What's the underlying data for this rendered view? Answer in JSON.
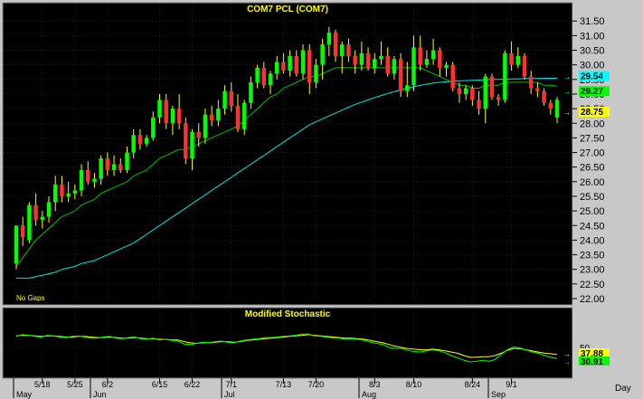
{
  "chart_data": [
    {
      "type": "candlestick",
      "title": "COM7  PCL  (COM7)",
      "note": "No Gaps",
      "ylim": [
        22.0,
        31.6
      ],
      "y_ticks": [
        "31.50",
        "31.00",
        "30.50",
        "30.00",
        "29.50",
        "29.00",
        "28.50",
        "28.00",
        "27.50",
        "27.00",
        "26.50",
        "26.00",
        "25.50",
        "25.00",
        "24.50",
        "24.00",
        "23.50",
        "23.00",
        "22.50",
        "22.00"
      ],
      "ma_labels": [
        "29.54",
        "29.27",
        "28.75"
      ],
      "ma_label_colors": [
        "#00ffff",
        "#00ff00",
        "#ffff00"
      ],
      "candle_colors": {
        "up": "#00ff00",
        "down": "#ff3030",
        "wick": "#ffff00"
      },
      "series_colors": {
        "ma_long": "#00e5e5",
        "ma_short": "#00c000"
      },
      "candles": [
        {
          "o": 23.2,
          "h": 24.5,
          "l": 23.0,
          "c": 24.5
        },
        {
          "o": 24.5,
          "h": 24.8,
          "l": 23.8,
          "c": 24.1
        },
        {
          "o": 24.0,
          "h": 25.3,
          "l": 23.9,
          "c": 25.2
        },
        {
          "o": 25.2,
          "h": 25.6,
          "l": 24.5,
          "c": 24.7
        },
        {
          "o": 24.7,
          "h": 25.0,
          "l": 24.4,
          "c": 24.8
        },
        {
          "o": 24.8,
          "h": 25.5,
          "l": 24.6,
          "c": 25.3
        },
        {
          "o": 25.3,
          "h": 26.2,
          "l": 25.0,
          "c": 25.9
        },
        {
          "o": 25.9,
          "h": 26.2,
          "l": 25.3,
          "c": 25.5
        },
        {
          "o": 25.5,
          "h": 26.0,
          "l": 25.3,
          "c": 25.6
        },
        {
          "o": 25.6,
          "h": 25.9,
          "l": 25.4,
          "c": 25.7
        },
        {
          "o": 25.7,
          "h": 26.6,
          "l": 25.5,
          "c": 26.4
        },
        {
          "o": 26.4,
          "h": 26.7,
          "l": 25.9,
          "c": 26.0
        },
        {
          "o": 26.0,
          "h": 26.3,
          "l": 25.8,
          "c": 26.1
        },
        {
          "o": 26.1,
          "h": 26.9,
          "l": 25.9,
          "c": 26.8
        },
        {
          "o": 26.8,
          "h": 27.0,
          "l": 26.2,
          "c": 26.4
        },
        {
          "o": 26.4,
          "h": 26.9,
          "l": 26.2,
          "c": 26.6
        },
        {
          "o": 26.6,
          "h": 26.8,
          "l": 26.3,
          "c": 26.4
        },
        {
          "o": 26.4,
          "h": 27.2,
          "l": 26.3,
          "c": 27.0
        },
        {
          "o": 27.0,
          "h": 27.8,
          "l": 26.8,
          "c": 27.6
        },
        {
          "o": 27.6,
          "h": 27.8,
          "l": 27.1,
          "c": 27.3
        },
        {
          "o": 27.3,
          "h": 27.6,
          "l": 27.2,
          "c": 27.5
        },
        {
          "o": 27.5,
          "h": 28.4,
          "l": 27.4,
          "c": 28.2
        },
        {
          "o": 28.2,
          "h": 29.0,
          "l": 28.0,
          "c": 28.8
        },
        {
          "o": 28.8,
          "h": 29.0,
          "l": 27.8,
          "c": 28.0
        },
        {
          "o": 28.0,
          "h": 28.6,
          "l": 27.6,
          "c": 28.5
        },
        {
          "o": 28.5,
          "h": 29.0,
          "l": 27.8,
          "c": 28.0
        },
        {
          "o": 28.0,
          "h": 28.2,
          "l": 26.6,
          "c": 26.8
        },
        {
          "o": 26.8,
          "h": 27.8,
          "l": 26.4,
          "c": 27.7
        },
        {
          "o": 27.7,
          "h": 28.0,
          "l": 27.2,
          "c": 27.5
        },
        {
          "o": 27.5,
          "h": 28.5,
          "l": 27.3,
          "c": 28.3
        },
        {
          "o": 28.3,
          "h": 28.6,
          "l": 27.9,
          "c": 28.1
        },
        {
          "o": 28.1,
          "h": 28.8,
          "l": 27.9,
          "c": 28.5
        },
        {
          "o": 28.5,
          "h": 29.3,
          "l": 28.3,
          "c": 29.1
        },
        {
          "o": 29.1,
          "h": 29.4,
          "l": 28.4,
          "c": 28.6
        },
        {
          "o": 28.6,
          "h": 29.0,
          "l": 27.7,
          "c": 27.8
        },
        {
          "o": 27.8,
          "h": 28.8,
          "l": 27.6,
          "c": 28.7
        },
        {
          "o": 28.7,
          "h": 29.6,
          "l": 28.5,
          "c": 29.4
        },
        {
          "o": 29.4,
          "h": 30.0,
          "l": 29.2,
          "c": 29.9
        },
        {
          "o": 29.9,
          "h": 30.1,
          "l": 29.2,
          "c": 29.3
        },
        {
          "o": 29.3,
          "h": 29.8,
          "l": 29.0,
          "c": 29.7
        },
        {
          "o": 29.7,
          "h": 30.3,
          "l": 29.5,
          "c": 30.1
        },
        {
          "o": 30.1,
          "h": 30.4,
          "l": 29.7,
          "c": 29.8
        },
        {
          "o": 29.8,
          "h": 30.5,
          "l": 29.6,
          "c": 30.3
        },
        {
          "o": 30.3,
          "h": 30.5,
          "l": 29.6,
          "c": 29.7
        },
        {
          "o": 29.7,
          "h": 30.7,
          "l": 29.5,
          "c": 30.5
        },
        {
          "o": 30.5,
          "h": 30.7,
          "l": 29.0,
          "c": 29.4
        },
        {
          "o": 29.4,
          "h": 30.2,
          "l": 29.2,
          "c": 30.0
        },
        {
          "o": 30.0,
          "h": 30.9,
          "l": 29.5,
          "c": 30.7
        },
        {
          "o": 30.7,
          "h": 31.3,
          "l": 30.3,
          "c": 31.1
        },
        {
          "o": 31.1,
          "h": 31.2,
          "l": 30.1,
          "c": 30.3
        },
        {
          "o": 30.3,
          "h": 30.8,
          "l": 29.7,
          "c": 30.7
        },
        {
          "o": 30.7,
          "h": 30.9,
          "l": 30.1,
          "c": 30.3
        },
        {
          "o": 30.3,
          "h": 30.5,
          "l": 29.7,
          "c": 30.0
        },
        {
          "o": 30.0,
          "h": 30.8,
          "l": 29.8,
          "c": 30.4
        },
        {
          "o": 30.4,
          "h": 30.6,
          "l": 29.8,
          "c": 29.9
        },
        {
          "o": 29.9,
          "h": 30.4,
          "l": 29.7,
          "c": 30.2
        },
        {
          "o": 30.2,
          "h": 30.8,
          "l": 30.0,
          "c": 30.3
        },
        {
          "o": 30.3,
          "h": 30.6,
          "l": 29.6,
          "c": 29.7
        },
        {
          "o": 29.7,
          "h": 30.3,
          "l": 29.5,
          "c": 30.2
        },
        {
          "o": 30.2,
          "h": 30.4,
          "l": 28.9,
          "c": 29.1
        },
        {
          "o": 29.1,
          "h": 30.1,
          "l": 28.9,
          "c": 29.3
        },
        {
          "o": 29.3,
          "h": 31.0,
          "l": 29.1,
          "c": 30.6
        },
        {
          "o": 30.6,
          "h": 31.0,
          "l": 29.8,
          "c": 30.0
        },
        {
          "o": 30.0,
          "h": 30.5,
          "l": 29.9,
          "c": 30.2
        },
        {
          "o": 30.2,
          "h": 30.9,
          "l": 30.0,
          "c": 30.5
        },
        {
          "o": 30.5,
          "h": 30.6,
          "l": 29.6,
          "c": 29.9
        },
        {
          "o": 29.9,
          "h": 30.1,
          "l": 29.6,
          "c": 30.0
        },
        {
          "o": 30.0,
          "h": 30.1,
          "l": 29.1,
          "c": 29.2
        },
        {
          "o": 29.2,
          "h": 29.4,
          "l": 28.7,
          "c": 29.0
        },
        {
          "o": 29.0,
          "h": 29.3,
          "l": 28.8,
          "c": 29.2
        },
        {
          "o": 29.2,
          "h": 29.3,
          "l": 28.6,
          "c": 28.8
        },
        {
          "o": 28.8,
          "h": 29.1,
          "l": 28.3,
          "c": 28.5
        },
        {
          "o": 28.5,
          "h": 29.7,
          "l": 28.0,
          "c": 29.6
        },
        {
          "o": 29.6,
          "h": 29.7,
          "l": 28.8,
          "c": 28.9
        },
        {
          "o": 28.9,
          "h": 29.0,
          "l": 28.6,
          "c": 28.8
        },
        {
          "o": 28.8,
          "h": 30.5,
          "l": 28.7,
          "c": 30.4
        },
        {
          "o": 30.4,
          "h": 30.8,
          "l": 29.8,
          "c": 30.0
        },
        {
          "o": 30.0,
          "h": 30.6,
          "l": 29.9,
          "c": 30.3
        },
        {
          "o": 30.3,
          "h": 30.4,
          "l": 29.5,
          "c": 29.6
        },
        {
          "o": 29.6,
          "h": 29.8,
          "l": 29.0,
          "c": 29.2
        },
        {
          "o": 29.2,
          "h": 29.4,
          "l": 28.9,
          "c": 29.1
        },
        {
          "o": 29.1,
          "h": 29.2,
          "l": 28.6,
          "c": 28.7
        },
        {
          "o": 28.7,
          "h": 28.8,
          "l": 28.3,
          "c": 28.5
        },
        {
          "o": 28.2,
          "h": 28.9,
          "l": 28.0,
          "c": 28.8
        }
      ],
      "ma_short": [
        23.1,
        23.4,
        23.7,
        24.0,
        24.2,
        24.4,
        24.6,
        24.8,
        24.9,
        25.0,
        25.2,
        25.3,
        25.4,
        25.6,
        25.7,
        25.8,
        25.9,
        26.0,
        26.2,
        26.3,
        26.4,
        26.6,
        26.8,
        26.9,
        27.0,
        27.1,
        27.1,
        27.2,
        27.3,
        27.4,
        27.5,
        27.6,
        27.7,
        27.8,
        27.9,
        28.1,
        28.3,
        28.5,
        28.7,
        28.9,
        29.0,
        29.2,
        29.3,
        29.4,
        29.5,
        29.6,
        29.6,
        29.7,
        29.8,
        29.9,
        29.9,
        29.9,
        29.9,
        29.9,
        29.9,
        29.9,
        29.9,
        29.9,
        29.9,
        29.9,
        29.9,
        29.9,
        29.9,
        29.8,
        29.7,
        29.6,
        29.5,
        29.4,
        29.3,
        29.3,
        29.2,
        29.2,
        29.3,
        29.3,
        29.3,
        29.4,
        29.4,
        29.4,
        29.4,
        29.4,
        29.4,
        29.3,
        29.3,
        29.27
      ],
      "ma_long": [
        22.7,
        22.7,
        22.7,
        22.75,
        22.8,
        22.85,
        22.9,
        23.0,
        23.05,
        23.1,
        23.2,
        23.25,
        23.3,
        23.4,
        23.5,
        23.6,
        23.7,
        23.8,
        23.9,
        24.05,
        24.2,
        24.35,
        24.5,
        24.65,
        24.8,
        24.95,
        25.1,
        25.25,
        25.4,
        25.55,
        25.7,
        25.85,
        26.0,
        26.15,
        26.3,
        26.45,
        26.6,
        26.75,
        26.9,
        27.05,
        27.2,
        27.35,
        27.5,
        27.65,
        27.8,
        27.95,
        28.05,
        28.15,
        28.25,
        28.35,
        28.45,
        28.55,
        28.65,
        28.72,
        28.8,
        28.88,
        28.95,
        29.02,
        29.08,
        29.14,
        29.2,
        29.25,
        29.3,
        29.34,
        29.38,
        29.4,
        29.42,
        29.44,
        29.45,
        29.46,
        29.47,
        29.48,
        29.49,
        29.5,
        29.5,
        29.51,
        29.52,
        29.52,
        29.53,
        29.53,
        29.53,
        29.54,
        29.54,
        29.54
      ]
    },
    {
      "type": "line",
      "title": "Modified  Stochastic",
      "ylim": [
        0,
        100
      ],
      "y_ticks": [
        "50"
      ],
      "value_labels": [
        "37.88",
        "30.91"
      ],
      "value_label_colors": [
        "#ffff00",
        "#00ff00"
      ],
      "series": [
        {
          "color": "#ffff00",
          "values": [
            70,
            71,
            71,
            70,
            69,
            70,
            70,
            69,
            68,
            68,
            69,
            69,
            68,
            67,
            67,
            68,
            67,
            66,
            66,
            67,
            66,
            65,
            65,
            64,
            64,
            63,
            63,
            60,
            58,
            57,
            58,
            58,
            59,
            60,
            60,
            59,
            60,
            62,
            63,
            64,
            65,
            66,
            67,
            68,
            69,
            70,
            71,
            72,
            71,
            70,
            69,
            68,
            67,
            66,
            66,
            65,
            64,
            62,
            60,
            58,
            55,
            52,
            50,
            48,
            47,
            46,
            46,
            47,
            46,
            44,
            42,
            40,
            36,
            33,
            33,
            34,
            34,
            36,
            40,
            45,
            48,
            48,
            46,
            44,
            42,
            40,
            39,
            37.88
          ]
        },
        {
          "color": "#00ff00",
          "values": [
            69,
            72,
            71,
            69,
            68,
            71,
            70,
            68,
            67,
            69,
            70,
            68,
            66,
            66,
            68,
            69,
            66,
            65,
            67,
            68,
            65,
            64,
            66,
            63,
            64,
            62,
            61,
            56,
            55,
            57,
            59,
            58,
            60,
            61,
            59,
            58,
            61,
            63,
            64,
            65,
            67,
            67,
            68,
            69,
            70,
            71,
            73,
            73,
            70,
            69,
            68,
            66,
            66,
            64,
            65,
            64,
            62,
            59,
            57,
            55,
            50,
            48,
            48,
            45,
            43,
            42,
            44,
            46,
            44,
            41,
            36,
            32,
            28,
            25,
            26,
            28,
            26,
            29,
            38,
            46,
            51,
            49,
            46,
            42,
            40,
            36,
            33,
            30.91
          ]
        }
      ]
    }
  ],
  "x_axis": {
    "day_ticks": [
      "5/18",
      "5/25",
      "6/2",
      "6/15",
      "6/22",
      "7/1",
      "7/13",
      "7/20",
      "8/3",
      "8/10",
      "8/24",
      "9/1"
    ],
    "month_labels": [
      "May",
      "Jun",
      "Jul",
      "Aug",
      "Sep"
    ],
    "period": "Day"
  }
}
